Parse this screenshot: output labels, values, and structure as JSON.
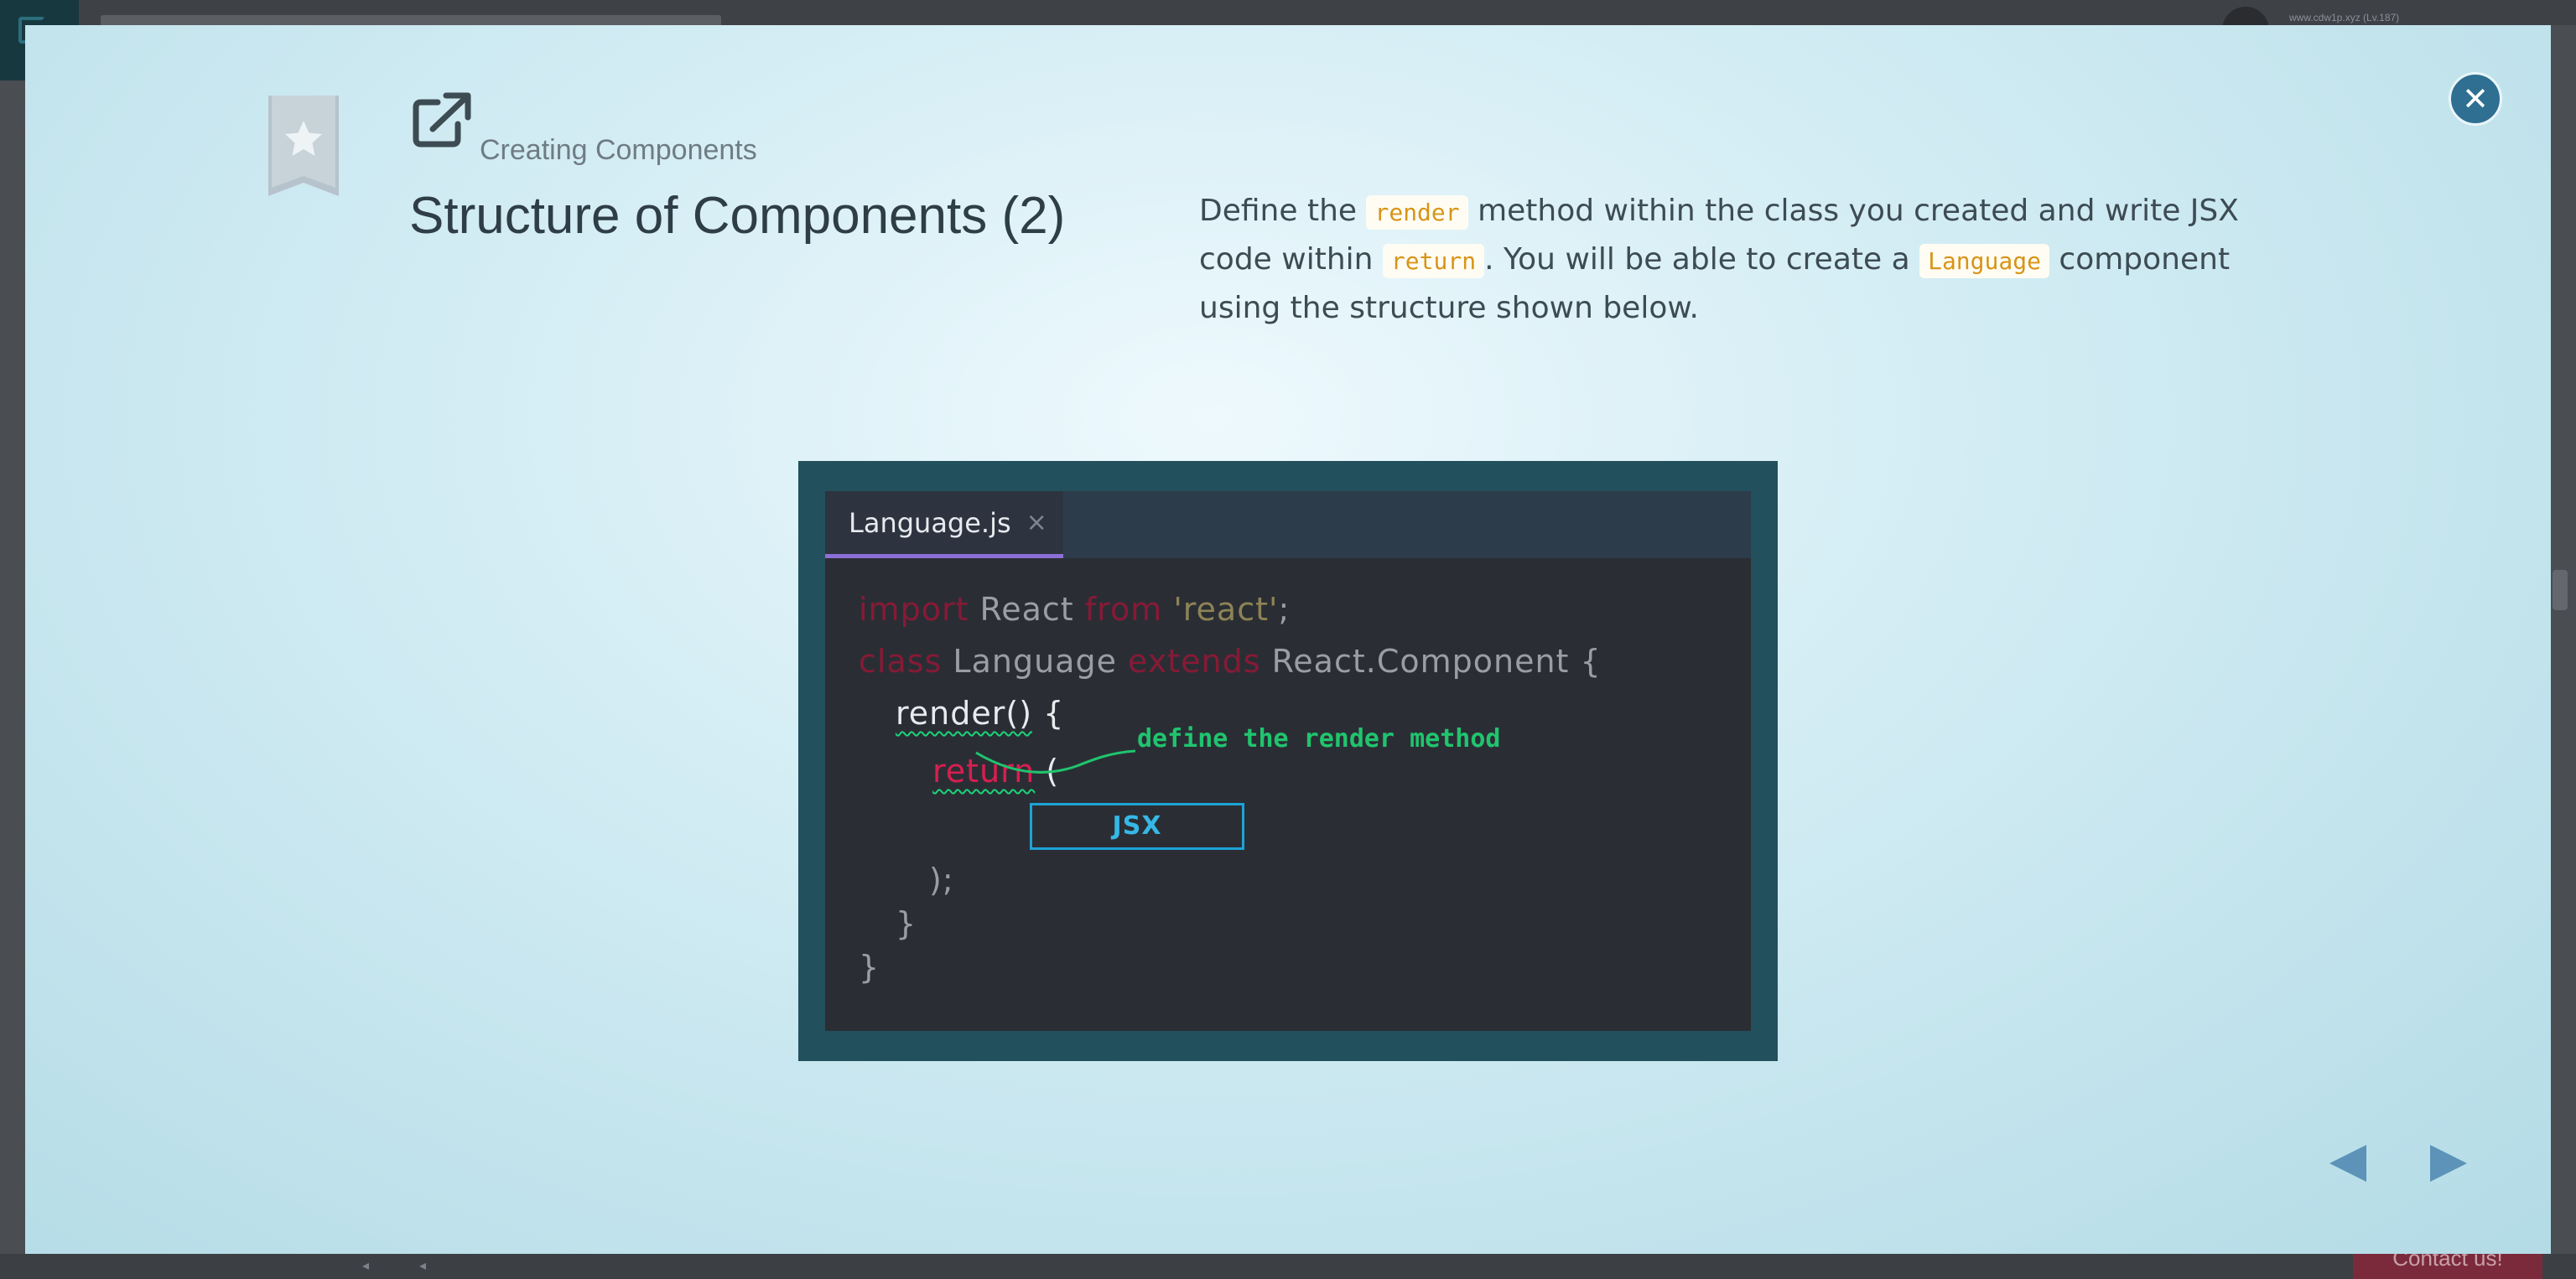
{
  "background": {
    "user_label": "www.cdw1p.xyz (Lv.187)",
    "contact_label": "Contact us!"
  },
  "lesson": {
    "breadcrumb": "Creating Components",
    "title": "Structure of Components (2)",
    "description": {
      "t1": "Define the ",
      "c1": "render",
      "t2": " method within the class you created and write JSX code within ",
      "c2": "return",
      "t3": ". You will be able to create a ",
      "c3": "Language",
      "t4": " component using the structure shown below."
    }
  },
  "editor": {
    "tab_label": "Language.js",
    "tab_close": "×",
    "lines": {
      "l1": {
        "kw1": "import",
        "t1": " React ",
        "kw2": "from",
        "t2": " ",
        "str": "'react'",
        "t3": ";"
      },
      "l2": {
        "kw1": "class",
        "t1": " Language ",
        "kw2": "extends",
        "t2": " React.Component {"
      },
      "l3": {
        "fn": "render()",
        "t1": " {"
      },
      "l4": {
        "kw": "return",
        "t1": " ("
      },
      "l5": {
        "jsx": "JSX"
      },
      "l6": {
        "t1": ");"
      },
      "l7": {
        "t1": "}"
      },
      "l8": {
        "t1": "}"
      }
    },
    "annotation": "define the render method"
  },
  "colors": {
    "accent": "#2f6f92",
    "code_chip_text": "#d89418",
    "annotation": "#20c46e",
    "jsx_border": "#1ea3d6"
  },
  "icons": {
    "close": "close-x-icon",
    "bookmark": "bookmark-star-icon",
    "external": "external-link-icon",
    "prev": "triangle-left-icon",
    "next": "triangle-right-icon"
  }
}
